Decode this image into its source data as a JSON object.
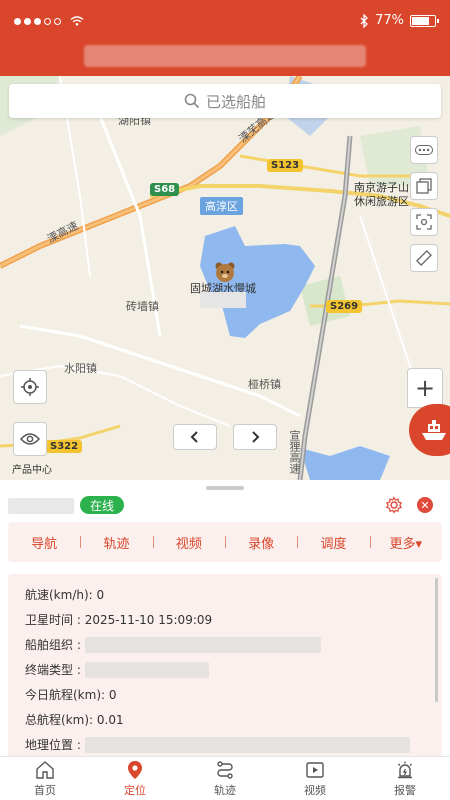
{
  "status_bar": {
    "battery": "77%",
    "battery_level": 0.77
  },
  "search": {
    "placeholder": "已选船舶"
  },
  "map": {
    "labels": {
      "hongfan": "湖阳镇",
      "nanjing": "南京游子山",
      "leisure": "休闲旅游区",
      "district": "高淳区",
      "expressway": "溧芜高速",
      "expressway2": "溧高速",
      "gucheng": "固城湖水慢城",
      "zhuanqiang": "砖墙镇",
      "shuiyang": "水阳镇",
      "yaqiao": "桠桥镇",
      "xuanhang": "宣狸高速"
    },
    "shields": {
      "s123": "S123",
      "s68": "S68",
      "s269": "S269",
      "s322": "S322"
    },
    "product_center": "产品中心"
  },
  "panel": {
    "status": "在线",
    "tabs": [
      "导航",
      "轨迹",
      "视频",
      "录像",
      "调度",
      "更多▾"
    ],
    "info": {
      "speed_label": "航速(km/h):",
      "speed_value": "0",
      "sat_time_label": "卫星时间 :",
      "sat_time_value": "2025-11-10 15:09:09",
      "org_label": "船舶组织 :",
      "terminal_label": "终端类型 :",
      "today_label": "今日航程(km):",
      "today_value": "0",
      "total_label": "总航程(km):",
      "total_value": "0.01",
      "location_label": "地理位置 :"
    }
  },
  "bottom_nav": [
    {
      "label": "首页",
      "icon": "home-icon"
    },
    {
      "label": "定位",
      "icon": "location-pin-icon"
    },
    {
      "label": "轨迹",
      "icon": "track-icon"
    },
    {
      "label": "视频",
      "icon": "video-icon"
    },
    {
      "label": "报警",
      "icon": "alarm-icon"
    }
  ],
  "colors": {
    "brand": "#d9462b",
    "online": "#2bb24c",
    "water": "#8fb8ee"
  }
}
